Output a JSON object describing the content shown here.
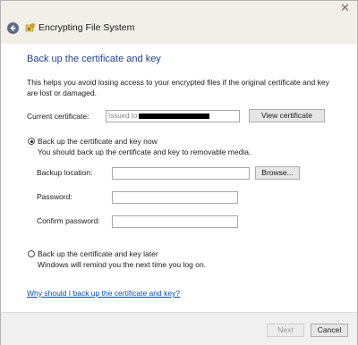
{
  "window": {
    "title": "Encrypting File System",
    "close_glyph": "✕"
  },
  "page": {
    "heading": "Back up the certificate and key",
    "description": "This helps you avoid losing access to your encrypted files if the original certificate and key are lost or damaged.",
    "current_certificate_label": "Current certificate:",
    "current_certificate_prefix": "Issued to",
    "view_certificate_label": "View certificate",
    "option_now_label": "Back up the certificate and key now",
    "option_now_subtext": "You should back up the certificate and key to removable media.",
    "backup_location_label": "Backup location:",
    "backup_location_value": "",
    "browse_label": "Browse...",
    "password_label": "Password:",
    "password_value": "",
    "confirm_password_label": "Confirm password:",
    "confirm_password_value": "",
    "option_later_label": "Back up the certificate and key later",
    "option_later_subtext": "Windows will remind you the next time you log on.",
    "help_link": "Why should I back up the certificate and key?",
    "selected_option": "now"
  },
  "footer": {
    "next_label": "Next",
    "cancel_label": "Cancel"
  },
  "colors": {
    "heading": "#1f3f8f",
    "link": "#0b4ea8",
    "titlebar": "#f2efe9"
  },
  "icons": {
    "back": "back-arrow-icon",
    "app": "efs-key-icon",
    "close": "close-icon"
  }
}
